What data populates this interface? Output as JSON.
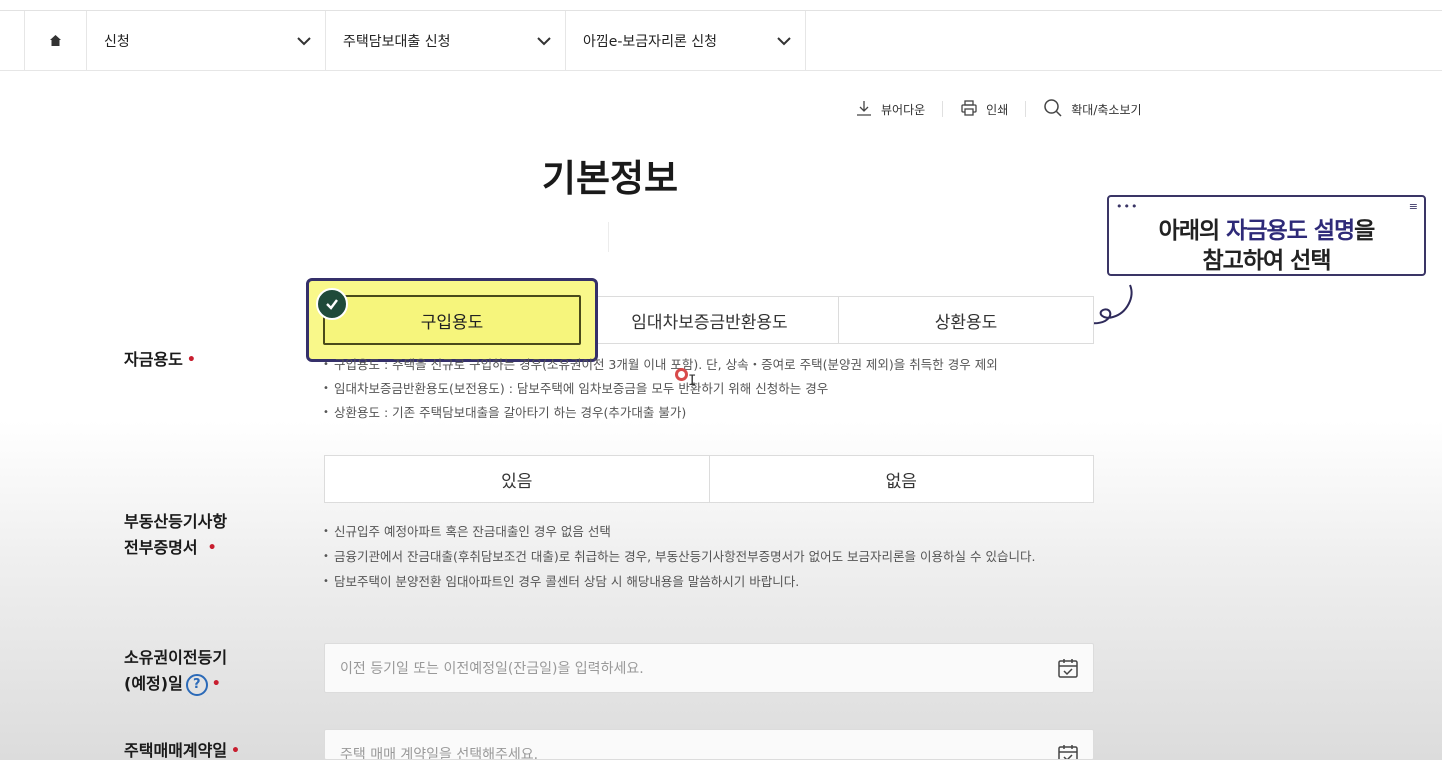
{
  "breadcrumb": {
    "home_icon": "home-icon",
    "items": [
      {
        "label": "신청"
      },
      {
        "label": "주택담보대출 신청"
      },
      {
        "label": "아낌e-보금자리론 신청"
      }
    ]
  },
  "tools": {
    "viewer_download": "뷰어다운",
    "print": "인쇄",
    "zoom": "확대/축소보기"
  },
  "page_title": "기본정보",
  "callout": {
    "line1_prefix": "아래의 ",
    "line1_highlight": "자금용도 설명",
    "line1_suffix": "을",
    "line2": "참고하여 선택",
    "accent_color": "#2e2a78"
  },
  "fund_use": {
    "label": "자금용도",
    "required_mark": "•",
    "options": [
      {
        "label": "구입용도",
        "selected": true
      },
      {
        "label": "임대차보증금반환용도",
        "selected": false
      },
      {
        "label": "상환용도",
        "selected": false
      }
    ],
    "notes": [
      "구입용도 : 주택을 신규로 구입하는 경우(소유권이전 3개월 이내 포함). 단, 상속・증여로 주택(분양권 제외)을 취득한 경우 제외",
      "임대차보증금반환용도(보전용도) : 담보주택에 임차보증금을 모두 반환하기 위해 신청하는 경우",
      "상환용도 : 기존 주택담보대출을 갈아타기 하는 경우(추가대출 불가)"
    ]
  },
  "registry": {
    "label_line1": "부동산등기사항",
    "label_line2": "전부증명서",
    "required_mark": "•",
    "options": [
      {
        "label": "있음"
      },
      {
        "label": "없음"
      }
    ],
    "notes": [
      "신규입주 예정아파트 혹은 잔금대출인 경우 없음 선택",
      "금융기관에서 잔금대출(후취담보조건 대출)로 취급하는 경우, 부동산등기사항전부증명서가 없어도 보금자리론을 이용하실 수 있습니다.",
      "담보주택이 분양전환 임대아파트인 경우 콜센터 상담 시 해당내용을 말씀하시기 바랍니다."
    ]
  },
  "ownership_transfer": {
    "label_line1": "소유권이전등기",
    "label_line2": "(예정)일",
    "help": "?",
    "required_mark": "•",
    "placeholder": "이전 등기일 또는 이전예정일(잔금일)을 입력하세요."
  },
  "contract_date": {
    "label": "주택매매계약일",
    "required_mark": "•",
    "placeholder": "주택 매매 계약일을 선택해주세요."
  }
}
